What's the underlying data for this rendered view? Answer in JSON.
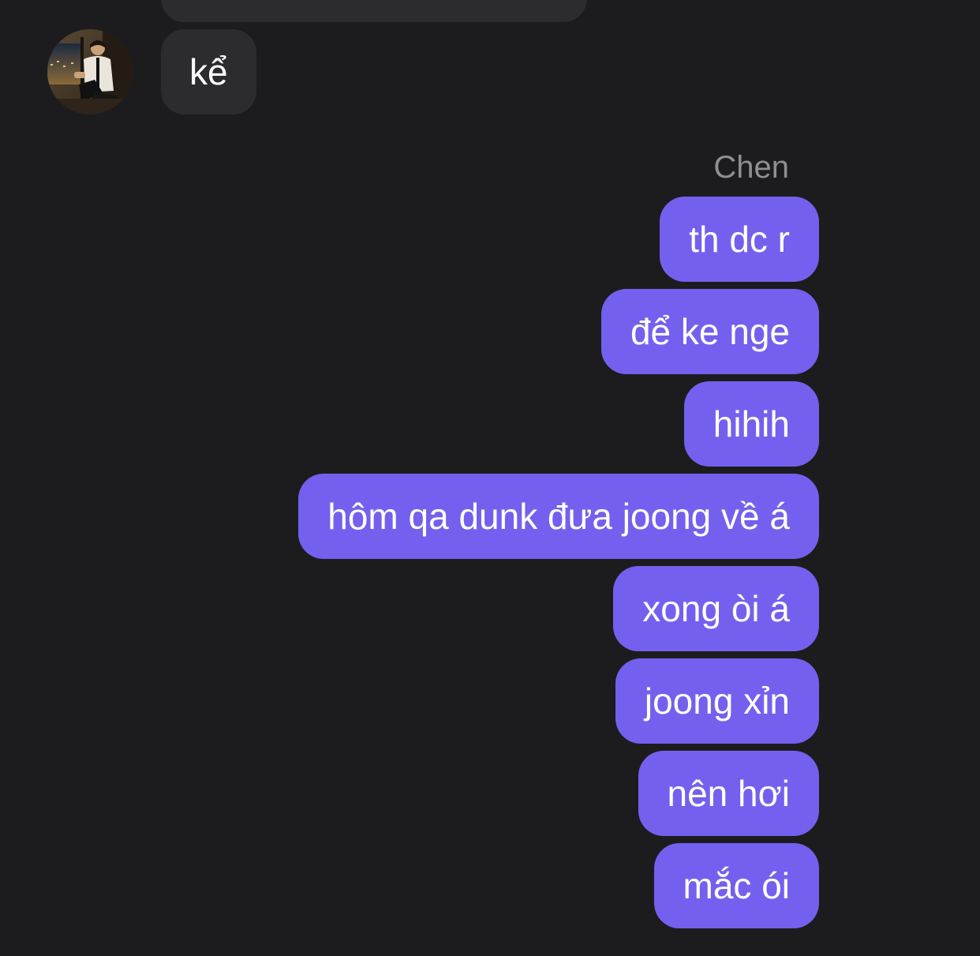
{
  "conversation": {
    "incoming": {
      "message": "kể"
    },
    "outgoing": {
      "sender": "Chen",
      "messages": [
        "th dc r",
        "để ke nge",
        "hihih",
        "hôm qa dunk đưa joong về á",
        "xong òi á",
        "joong xỉn",
        "nên hơi",
        "mắc ói"
      ]
    }
  },
  "colors": {
    "background": "#1c1c1e",
    "incoming_bubble": "#2c2c2e",
    "outgoing_bubble": "#7460ee",
    "sender_name": "#8e8e93"
  }
}
